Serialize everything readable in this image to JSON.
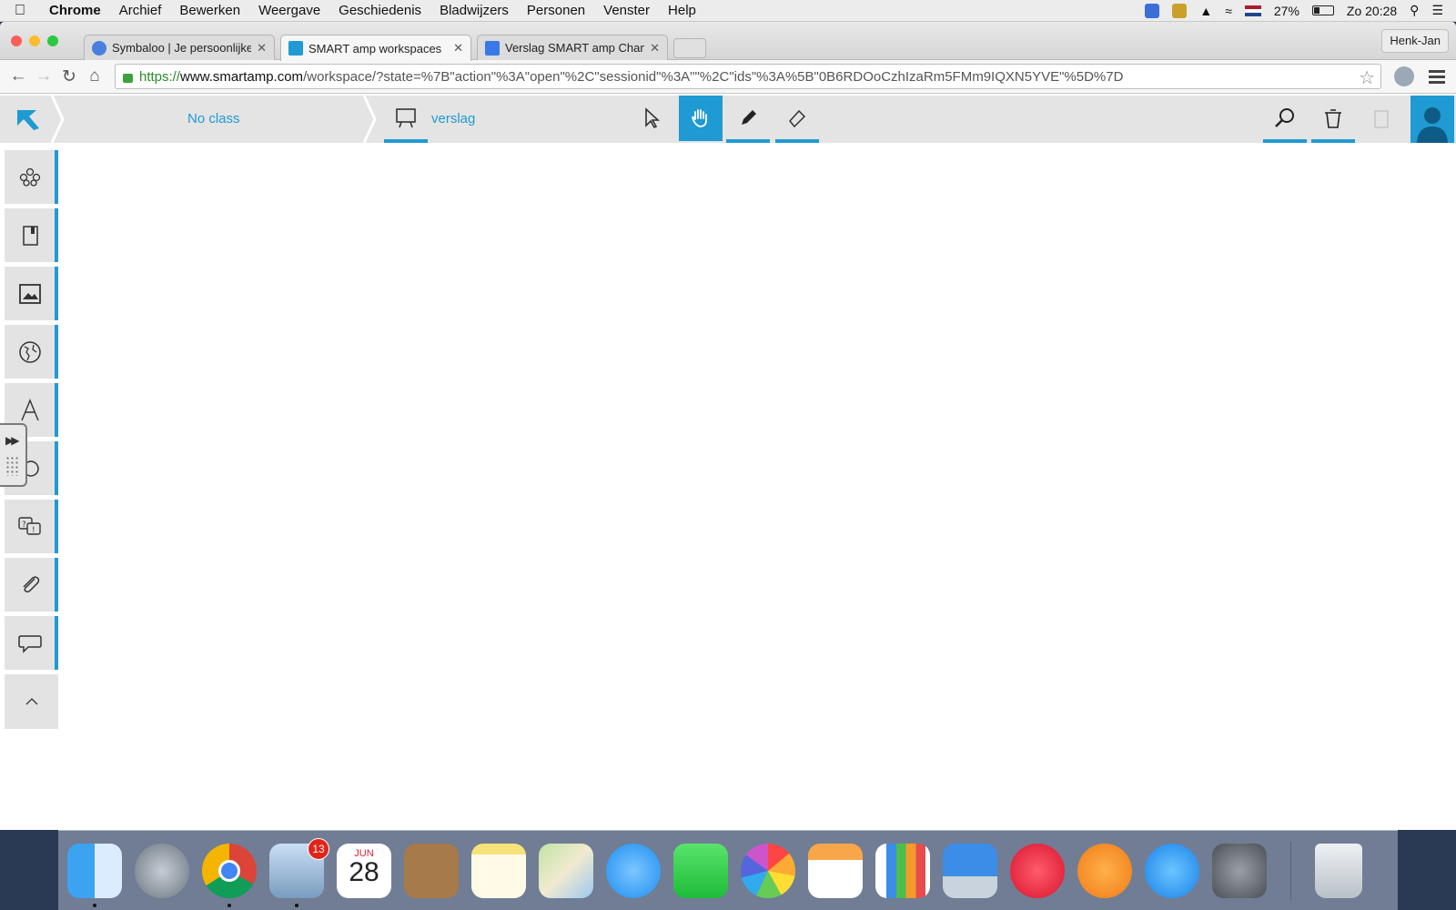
{
  "menubar": {
    "app_name": "Chrome",
    "items": [
      "Archief",
      "Bewerken",
      "Weergave",
      "Geschiedenis",
      "Bladwijzers",
      "Personen",
      "Venster",
      "Help"
    ],
    "battery_percent": "27%",
    "clock": "Zo 20:28"
  },
  "browser": {
    "tabs": [
      {
        "label": "Symbaloo | Je persoonlijke",
        "favicon_color": "#4a7fe0"
      },
      {
        "label": "SMART amp workspaces",
        "favicon_color": "#1f9ad2"
      },
      {
        "label": "Verslag SMART amp Cham",
        "favicon_color": "#3b78e7"
      }
    ],
    "profile_name": "Henk-Jan",
    "url": {
      "scheme": "https://",
      "host": "www.smartamp.com",
      "path": "/workspace/?state=%7B\"action\"%3A\"open\"%2C\"sessionid\"%3A\"\"%2C\"ids\"%3A%5B\"0B6RDOoCzhIzaRm5FMm9IQXN5YVE\"%5D%7D"
    }
  },
  "app": {
    "class_label": "No class",
    "workspace_name": "verslag",
    "accent_color": "#1f9ad2",
    "tools": [
      "select-icon",
      "hand-icon",
      "pen-icon",
      "eraser-icon"
    ],
    "active_tool": "hand-icon",
    "right_tools": [
      "search-icon",
      "trash-icon",
      "paste-icon",
      "user-icon"
    ],
    "sidebar_items": [
      "groups-icon",
      "book-icon",
      "image-icon",
      "globe-icon",
      "text-icon",
      "shape-icon",
      "question-icon",
      "attachment-icon",
      "comment-icon",
      "collapse-icon"
    ]
  },
  "dock": {
    "apps": [
      "finder-icon",
      "launchpad-icon",
      "chrome-icon",
      "mail-icon",
      "calendar-icon",
      "contacts-icon",
      "notes-icon",
      "maps-icon",
      "messages-icon",
      "facetime-icon",
      "photos-icon",
      "pages-icon",
      "numbers-icon",
      "keynote-icon",
      "itunes-icon",
      "ibooks-icon",
      "appstore-icon",
      "system-preferences-icon",
      "trash-icon"
    ],
    "mail_badge": "13",
    "calendar_month": "JUN",
    "calendar_day": "28"
  }
}
